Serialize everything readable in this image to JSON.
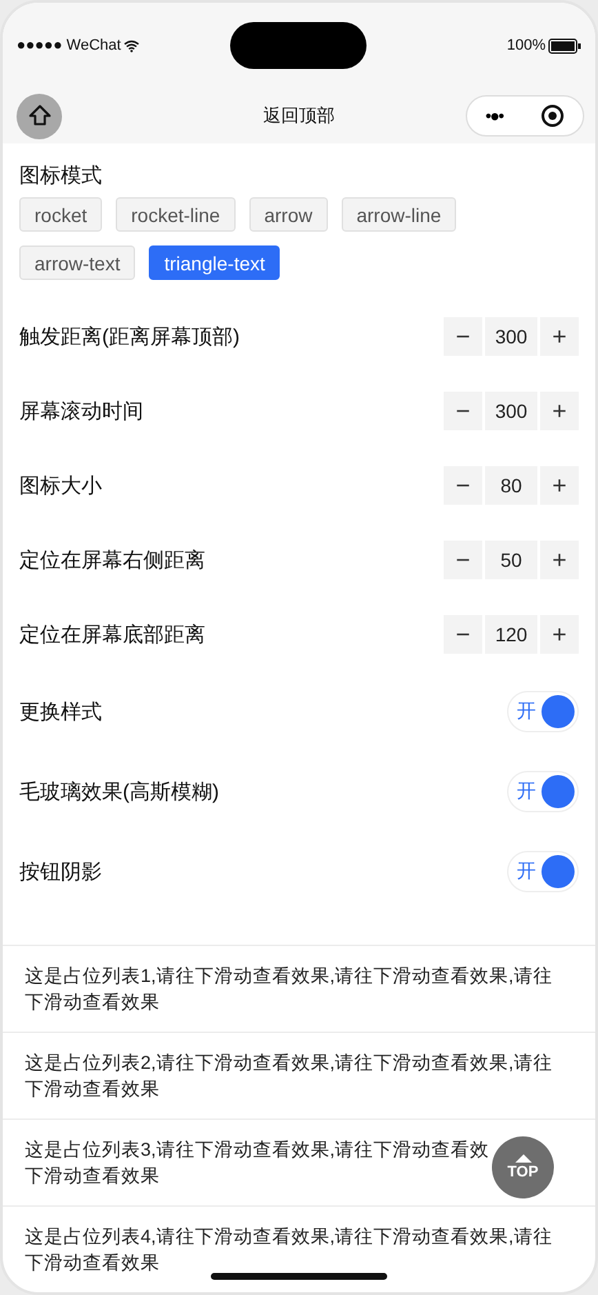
{
  "status_bar": {
    "carrier": "●●●●● WeChat",
    "battery": "100%"
  },
  "nav": {
    "title": "返回顶部",
    "menu": "•●•"
  },
  "icon_mode": {
    "title": "图标模式",
    "options": [
      {
        "label": "rocket",
        "selected": false
      },
      {
        "label": "rocket-line",
        "selected": false
      },
      {
        "label": "arrow",
        "selected": false
      },
      {
        "label": "arrow-line",
        "selected": false
      },
      {
        "label": "arrow-text",
        "selected": false
      },
      {
        "label": "triangle-text",
        "selected": true
      }
    ]
  },
  "steppers": [
    {
      "label": "触发距离(距离屏幕顶部)",
      "value": "300",
      "minus": "−",
      "plus": "+"
    },
    {
      "label": "屏幕滚动时间",
      "value": "300",
      "minus": "−",
      "plus": "+"
    },
    {
      "label": "图标大小",
      "value": "80",
      "minus": "−",
      "plus": "+"
    },
    {
      "label": "定位在屏幕右侧距离",
      "value": "50",
      "minus": "−",
      "plus": "+"
    },
    {
      "label": "定位在屏幕底部距离",
      "value": "120",
      "minus": "−",
      "plus": "+"
    }
  ],
  "switches": [
    {
      "label": "更换样式",
      "on": true,
      "text": "开"
    },
    {
      "label": "毛玻璃效果(高斯模糊)",
      "on": true,
      "text": "开"
    },
    {
      "label": "按钮阴影",
      "on": true,
      "text": "开"
    }
  ],
  "list": [
    {
      "lines": [
        "这是占位列表1,请往下滑动查看效果,请往下滑动查看效果,请往",
        "下滑动查看效果"
      ]
    },
    {
      "lines": [
        "这是占位列表2,请往下滑动查看效果,请往下滑动查看效果,请往",
        "下滑动查看效果"
      ]
    },
    {
      "lines": [
        "这是占位列表3,请往下滑动查看效果,请往下滑动查看效",
        "下滑动查看效果"
      ]
    },
    {
      "lines": [
        "这是占位列表4,请往下滑动查看效果,请往下滑动查看效果,请往",
        "下滑动查看效果"
      ]
    }
  ],
  "back_to_top": {
    "label": "TOP"
  }
}
